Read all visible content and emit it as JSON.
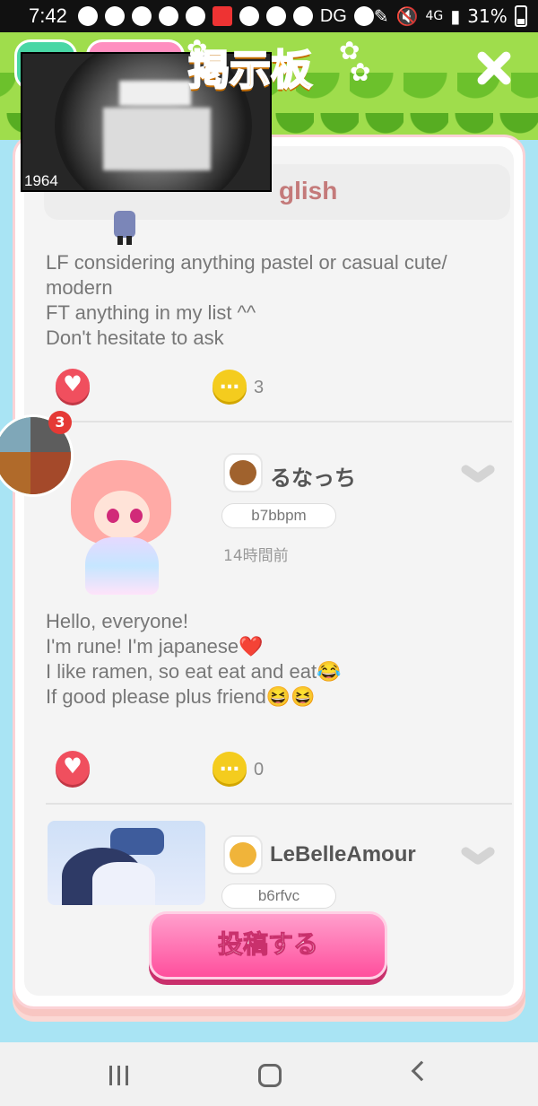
{
  "status_bar": {
    "time": "7:42",
    "dg_label": "DG",
    "network": "4G",
    "battery": "31%"
  },
  "header": {
    "title": "掲示板"
  },
  "language_tab": {
    "label": "glish"
  },
  "video_overlay": {
    "timestamp": "1964"
  },
  "bubble": {
    "badge_count": "3"
  },
  "posts": [
    {
      "text_lines": [
        "LF considering anything pastel or casual cute/",
        "modern",
        "FT anything in my list ^^",
        "Don't hesitate to ask"
      ],
      "comment_count": "3"
    },
    {
      "username": "るなっち",
      "user_id": "b7bbpm",
      "time_ago": "14時間前",
      "text_lines": [
        "Hello, everyone!",
        "I'm rune! I'm japanese❤️",
        "I like ramen, so eat eat and eat😂",
        "If good please plus friend😆😆"
      ],
      "comment_count": "0"
    },
    {
      "username": "LeBelleAmour",
      "user_id": "b6rfvc"
    }
  ],
  "post_button": {
    "label": "投稿する"
  }
}
